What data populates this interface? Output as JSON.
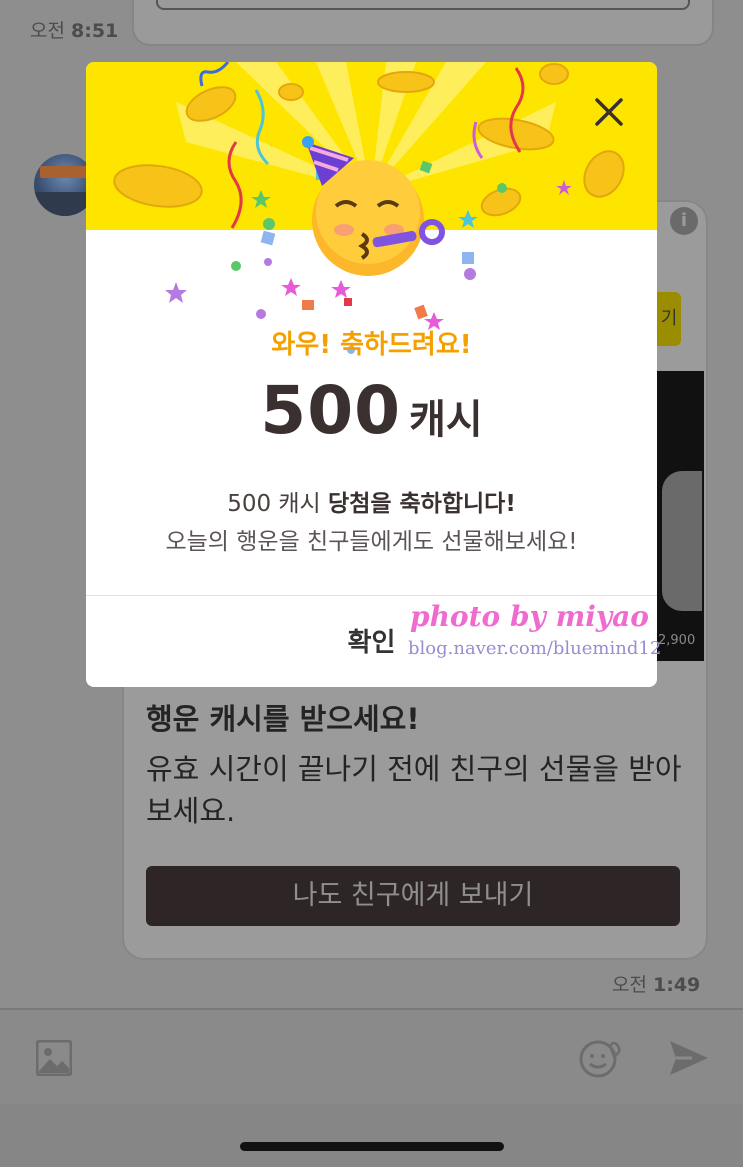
{
  "chat": {
    "time_top_prefix": "오전",
    "time_top_value": "8:51",
    "time_bottom_prefix": "오전",
    "time_bottom_value": "1:49",
    "info_glyph": "i",
    "yellow_button_glyph": "기",
    "image_price": "2,900",
    "card_title": "행운 캐시를 받으세요!",
    "card_body": "유효 시간이 끝나기 전에 친구의 선물을 받아 보세요.",
    "send_button_label": "나도 친구에게 보내기"
  },
  "modal": {
    "subtitle": "와우! 축하드려요!",
    "amount": "500",
    "amount_unit": "캐시",
    "desc_amount": "500 캐시",
    "desc_rest": "당첨을 축하합니다!",
    "desc_line2": "오늘의 행운을 친구들에게도 선물해보세요!",
    "confirm_label": "확인"
  },
  "watermark": {
    "line1": "photo by miyao",
    "line2": "blog.naver.com/bluemind12"
  },
  "colors": {
    "accent_yellow": "#fee500",
    "subtitle_orange": "#f4a000",
    "dark_button": "#2e2626"
  },
  "icons": [
    "close-icon",
    "image-attach-icon",
    "emoji-icon",
    "send-icon",
    "info-icon",
    "party-face-emoji"
  ]
}
